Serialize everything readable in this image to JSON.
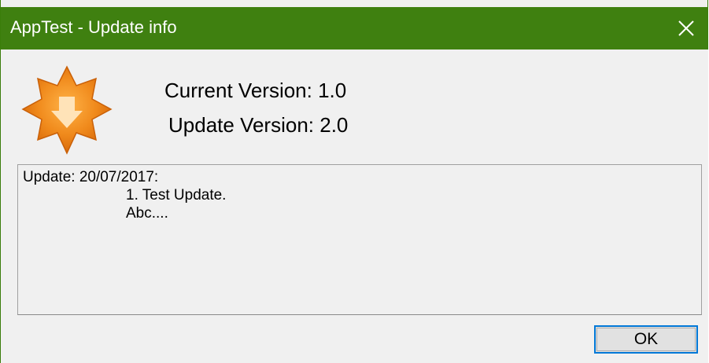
{
  "window": {
    "title": "AppTest - Update info",
    "titlebar_color": "#3f8010"
  },
  "versions": {
    "current": "Current Version: 1.0",
    "update": "Update Version: 2.0"
  },
  "notes": {
    "lines": [
      "Update: 20/07/2017:",
      "1. Test Update.",
      "Abc...."
    ]
  },
  "buttons": {
    "ok_label": "OK"
  },
  "icons": {
    "app": "update-badge-icon",
    "close": "close-icon"
  }
}
